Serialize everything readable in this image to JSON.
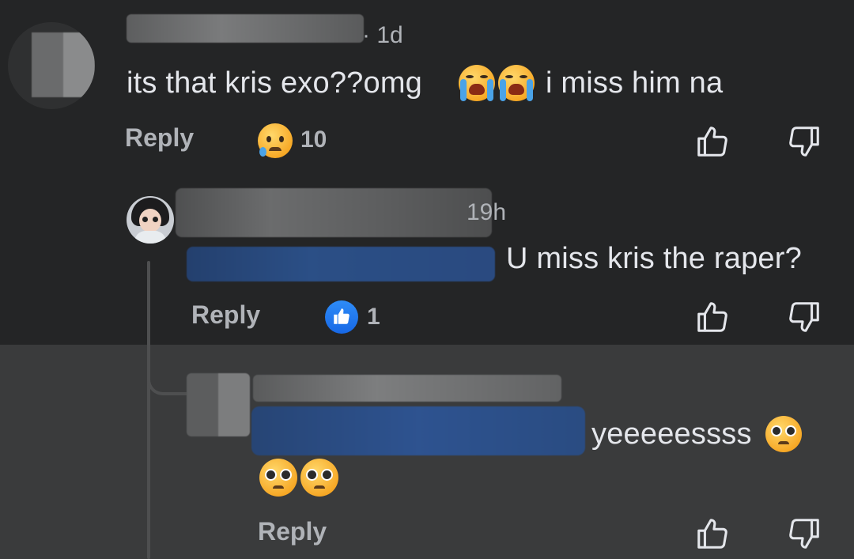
{
  "comments": [
    {
      "time": "· 1d",
      "text": "its that kris exo??omg",
      "text_tail": "i miss him na",
      "reply_label": "Reply",
      "reaction": {
        "emoji": "sad-but-relieved-face",
        "count": "10"
      }
    },
    {
      "time": "19h",
      "text": "U miss kris the raper?",
      "reply_label": "Reply",
      "reaction": {
        "emoji": "like",
        "count": "1"
      }
    },
    {
      "text": "yeeeeessss",
      "reply_label": "Reply"
    }
  ],
  "icons": {
    "like": "thumbs-up-outline-icon",
    "dislike": "thumbs-down-outline-icon"
  },
  "colors": {
    "background": "#242526",
    "highlight_band": "#3a3b3c",
    "text": "#e4e6eb",
    "muted": "#b0b3b8",
    "like_blue": "#1877f2"
  }
}
